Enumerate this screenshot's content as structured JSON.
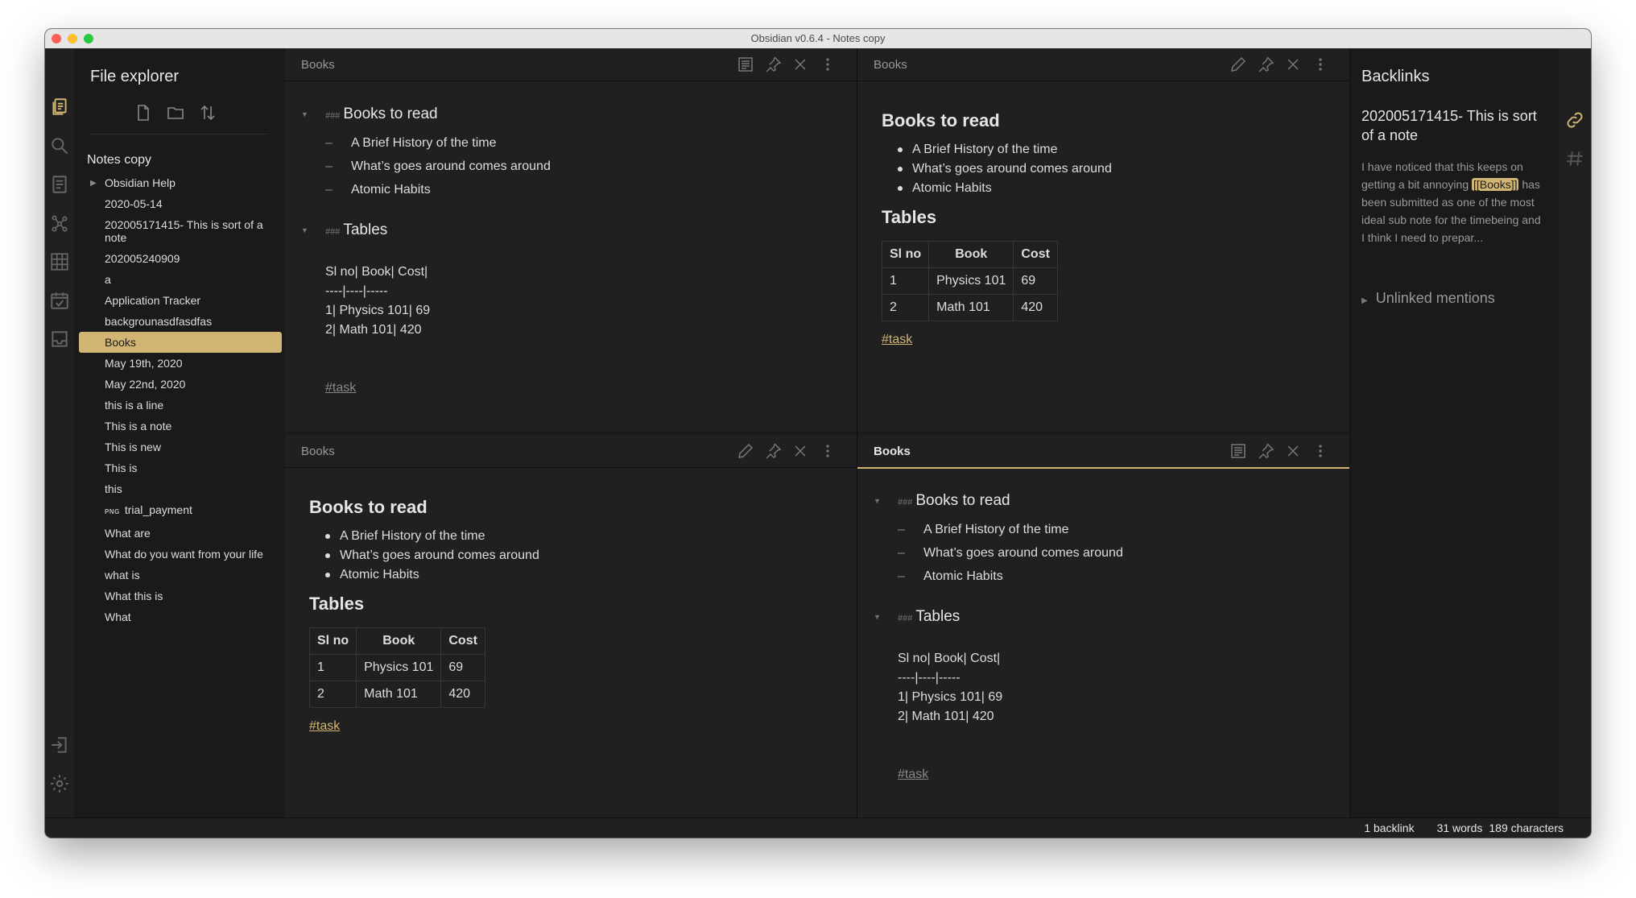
{
  "window": {
    "title": "Obsidian v0.6.4 - Notes copy"
  },
  "sidebar": {
    "title": "File explorer",
    "vault": "Notes copy",
    "files": [
      {
        "label": "Obsidian Help",
        "folder": true
      },
      {
        "label": "2020-05-14"
      },
      {
        "label": "202005171415- This is sort of a note"
      },
      {
        "label": "202005240909"
      },
      {
        "label": "a"
      },
      {
        "label": "Application Tracker"
      },
      {
        "label": "backgrounasdfasdfas"
      },
      {
        "label": "Books",
        "active": true
      },
      {
        "label": "May 19th, 2020"
      },
      {
        "label": "May 22nd, 2020"
      },
      {
        "label": "this is a line"
      },
      {
        "label": "This is a note"
      },
      {
        "label": "This is new"
      },
      {
        "label": "This is"
      },
      {
        "label": "this"
      },
      {
        "label": "trial_payment",
        "badge": "PNG"
      },
      {
        "label": "What are"
      },
      {
        "label": "What do you want from your life"
      },
      {
        "label": "what is"
      },
      {
        "label": "What this is"
      },
      {
        "label": "What"
      }
    ]
  },
  "note": {
    "tab_title": "Books",
    "h_books": "Books to read",
    "h_tables": "Tables",
    "hash_marks": "###",
    "list_items": [
      "A Brief History of the time",
      "What’s goes around comes around",
      "Atomic Habits"
    ],
    "source_table_lines": [
      "Sl no| Book| Cost|",
      "----|----|-----",
      "1| Physics 101| 69",
      "2| Math 101| 420"
    ],
    "table": {
      "headers": [
        "Sl no",
        "Book",
        "Cost"
      ],
      "rows": [
        [
          "1",
          "Physics 101",
          "69"
        ],
        [
          "2",
          "Math 101",
          "420"
        ]
      ]
    },
    "tag": "#task"
  },
  "backlinks": {
    "title": "Backlinks",
    "note_title": "202005171415- This is sort of a note",
    "snippet_before": "I have noticed that this keeps on getting a bit annoying ",
    "snippet_link": "[[Books]]",
    "snippet_after": " has been submitted as one of the most ideal sub note for the timebeing and I think I need to prepar...",
    "unlinked": "Unlinked mentions"
  },
  "status": {
    "backlinks": "1 backlink",
    "words": "31 words",
    "chars": "189 characters"
  },
  "colors": {
    "accent": "#d2b574",
    "background": "#202020",
    "sidebar": "#1a1a1a"
  },
  "icons": {
    "ribbon": [
      "files-icon",
      "search-icon",
      "pages-icon",
      "graph-icon",
      "grid-icon",
      "calendar-check-icon",
      "inbox-icon",
      "open-vault-icon",
      "settings-icon"
    ],
    "right_ribbon": [
      "link-icon",
      "tag-icon"
    ]
  }
}
